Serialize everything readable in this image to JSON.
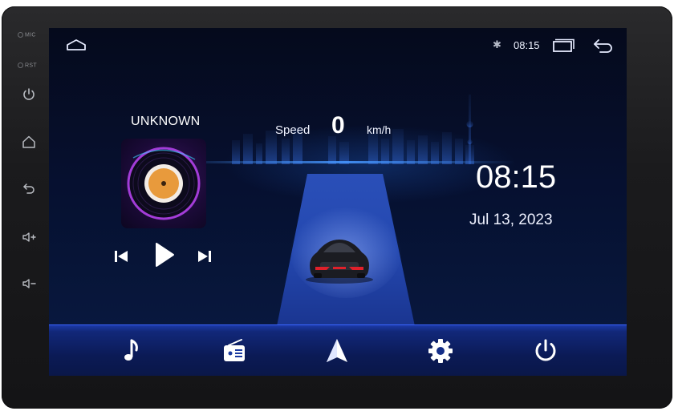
{
  "bezel": {
    "mic_label": "MIC",
    "rst_label": "RST",
    "keys": [
      "power-icon",
      "home-icon",
      "back-icon",
      "volume-up-icon",
      "volume-down-icon"
    ]
  },
  "status_bar": {
    "time": "08:15",
    "bluetooth_icon": "bluetooth-icon",
    "bluetooth_glyph": "✱"
  },
  "media": {
    "track_title": "UNKNOWN"
  },
  "speed": {
    "label": "Speed",
    "value": "0",
    "unit": "km/h"
  },
  "clock": {
    "time": "08:15",
    "date": "Jul 13, 2023"
  },
  "dock": {
    "items": [
      "music-icon",
      "radio-icon",
      "navigation-icon",
      "settings-icon",
      "power-icon"
    ]
  },
  "colors": {
    "accent": "#3a64ff",
    "background": "#061030",
    "text": "#ffffff"
  }
}
